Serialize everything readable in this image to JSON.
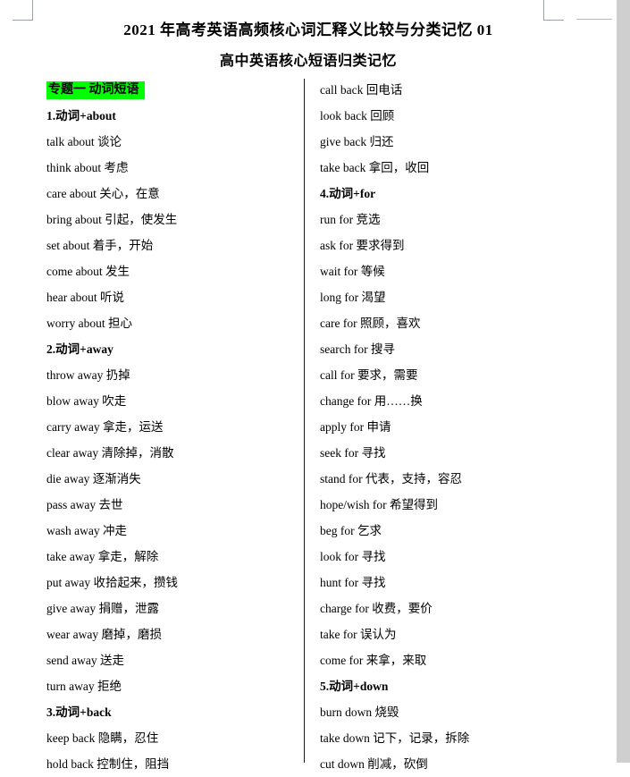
{
  "document": {
    "title": "2021 年高考英语高频核心词汇释义比较与分类记忆 01",
    "subtitle": "高中英语核心短语归类记忆",
    "topic_heading": "专题一   动词短语",
    "highlight_color": "#00ff00",
    "divider_color": "#1a1a1a",
    "page_background": "#ffffff",
    "gutter_color": "#cfcfcf"
  },
  "columns": {
    "left": [
      {
        "type": "highlight",
        "text": "专题一   动词短语"
      },
      {
        "type": "section",
        "text": "1.动词+about"
      },
      {
        "type": "entry",
        "text": "talk about 谈论"
      },
      {
        "type": "entry",
        "text": "think about 考虑"
      },
      {
        "type": "entry",
        "text": "care about 关心，在意"
      },
      {
        "type": "entry",
        "text": "bring about 引起，使发生"
      },
      {
        "type": "entry",
        "text": "set about 着手，开始"
      },
      {
        "type": "entry",
        "text": "come about 发生"
      },
      {
        "type": "entry",
        "text": "hear about 听说"
      },
      {
        "type": "entry",
        "text": "worry about 担心"
      },
      {
        "type": "section",
        "text": "2.动词+away"
      },
      {
        "type": "entry",
        "text": "throw away 扔掉"
      },
      {
        "type": "entry",
        "text": "blow away 吹走"
      },
      {
        "type": "entry",
        "text": "carry away 拿走，运送"
      },
      {
        "type": "entry",
        "text": "clear away 清除掉，消散"
      },
      {
        "type": "entry",
        "text": "die away 逐渐消失"
      },
      {
        "type": "entry",
        "text": "pass away 去世"
      },
      {
        "type": "entry",
        "text": "wash away 冲走"
      },
      {
        "type": "entry",
        "text": "take away 拿走，解除"
      },
      {
        "type": "entry",
        "text": "put away 收拾起来，攒钱"
      },
      {
        "type": "entry",
        "text": "give away 捐赠，泄露"
      },
      {
        "type": "entry",
        "text": "wear away 磨掉，磨损"
      },
      {
        "type": "entry",
        "text": "send away 送走"
      },
      {
        "type": "entry",
        "text": "turn away 拒绝"
      },
      {
        "type": "section",
        "text": "3.动词+back"
      },
      {
        "type": "entry",
        "text": "keep back 隐瞒，忍住"
      },
      {
        "type": "entry",
        "text": "hold back 控制住，阻挡"
      }
    ],
    "right": [
      {
        "type": "entry",
        "text": "call back 回电话"
      },
      {
        "type": "entry",
        "text": "look back 回顾"
      },
      {
        "type": "entry",
        "text": "give back 归还"
      },
      {
        "type": "entry",
        "text": "take back 拿回，收回"
      },
      {
        "type": "section",
        "text": "4.动词+for"
      },
      {
        "type": "entry",
        "text": "run for 竞选"
      },
      {
        "type": "entry",
        "text": "ask for 要求得到"
      },
      {
        "type": "entry",
        "text": "wait for 等候"
      },
      {
        "type": "entry",
        "text": "long for 渴望"
      },
      {
        "type": "entry",
        "text": "care for 照顾，喜欢"
      },
      {
        "type": "entry",
        "text": "search for 搜寻"
      },
      {
        "type": "entry",
        "text": "call for 要求，需要"
      },
      {
        "type": "entry",
        "text": "change for 用……换"
      },
      {
        "type": "entry",
        "text": "apply for 申请"
      },
      {
        "type": "entry",
        "text": "seek for 寻找"
      },
      {
        "type": "entry",
        "text": "stand for 代表，支持，容忍"
      },
      {
        "type": "entry",
        "text": "hope/wish for 希望得到"
      },
      {
        "type": "entry",
        "text": "beg for 乞求"
      },
      {
        "type": "entry",
        "text": "look for 寻找"
      },
      {
        "type": "entry",
        "text": "hunt for 寻找"
      },
      {
        "type": "entry",
        "text": "charge for 收费，要价"
      },
      {
        "type": "entry",
        "text": "take for 误认为"
      },
      {
        "type": "entry",
        "text": "come for 来拿，来取"
      },
      {
        "type": "section",
        "text": "5.动词+down"
      },
      {
        "type": "entry",
        "text": "burn down 烧毁"
      },
      {
        "type": "entry",
        "text": "take down 记下，记录，拆除"
      },
      {
        "type": "entry",
        "text": "cut down 削减，砍倒"
      }
    ]
  }
}
